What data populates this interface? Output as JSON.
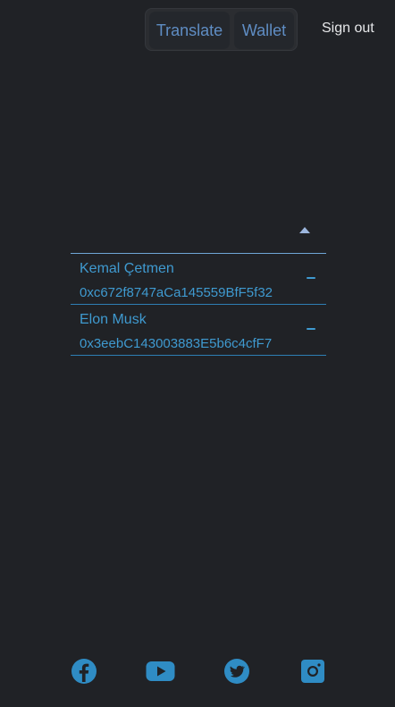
{
  "nav": {
    "tabs": [
      {
        "label": "Translate"
      },
      {
        "label": "Wallet"
      }
    ],
    "sign_out": "Sign out"
  },
  "contacts": [
    {
      "name": "Kemal Çetmen",
      "address": "0xc672f8747aCa145559BfF5f32"
    },
    {
      "name": "Elon Musk",
      "address": "0x3eebC143003883E5b6c4cfF7"
    }
  ],
  "footer": {
    "socials": [
      "facebook-icon",
      "youtube-icon",
      "twitter-icon",
      "instagram-icon"
    ]
  },
  "colors": {
    "background": "#202226",
    "accent": "#3f9ad0",
    "tab_text": "#5f8dc4"
  }
}
